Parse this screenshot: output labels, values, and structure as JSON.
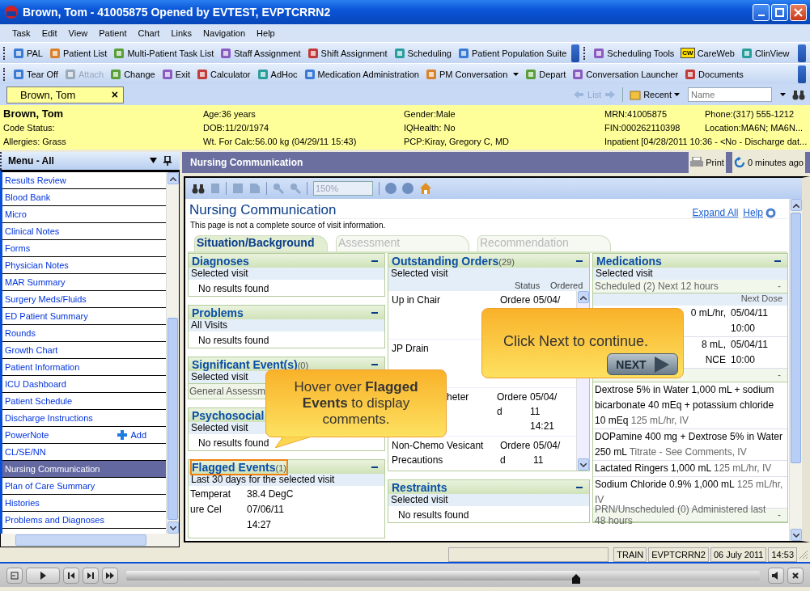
{
  "window": {
    "title": "Brown, Tom - 41005875 Opened by EVTEST, EVPTCRRN2"
  },
  "menu": [
    "Task",
    "Edit",
    "View",
    "Patient",
    "Chart",
    "Links",
    "Navigation",
    "Help"
  ],
  "toolbar_1": {
    "left": [
      {
        "label": "PAL"
      },
      {
        "label": "Patient List"
      },
      {
        "label": "Multi-Patient Task List"
      },
      {
        "label": "Staff Assignment"
      },
      {
        "label": "Shift Assignment"
      },
      {
        "label": "Scheduling"
      },
      {
        "label": "Patient Population Suite"
      }
    ],
    "right": [
      {
        "label": "Scheduling Tools"
      },
      {
        "label": "CareWeb",
        "icon_text": "CW"
      },
      {
        "label": "ClinView"
      }
    ]
  },
  "toolbar_2": [
    {
      "label": "Tear Off",
      "disabled": false,
      "dropdown": false
    },
    {
      "label": "Attach",
      "disabled": true,
      "dropdown": false
    },
    {
      "label": "Change",
      "disabled": false,
      "dropdown": false
    },
    {
      "label": "Exit",
      "disabled": false,
      "dropdown": false
    },
    {
      "label": "Calculator",
      "disabled": false,
      "dropdown": false
    },
    {
      "label": "AdHoc",
      "disabled": false,
      "dropdown": false
    },
    {
      "label": "Medication Administration",
      "disabled": false,
      "dropdown": false
    },
    {
      "label": "PM Conversation",
      "disabled": false,
      "dropdown": true
    },
    {
      "label": "Depart",
      "disabled": false,
      "dropdown": false
    },
    {
      "label": "Conversation Launcher",
      "disabled": false,
      "dropdown": false
    },
    {
      "label": "Documents",
      "disabled": false,
      "dropdown": false
    }
  ],
  "patient_tab": {
    "label": "Brown, Tom",
    "close": "×"
  },
  "nav": {
    "list": "List",
    "recent": "Recent",
    "placeholder": "Name"
  },
  "banner": [
    [
      "Brown, Tom",
      "Age:36 years",
      "Gender:Male",
      "MRN:41005875",
      "Phone:(317) 555-1212"
    ],
    [
      "Code Status:",
      "DOB:11/20/1974",
      "IQHealth: No",
      "FIN:000262110398",
      "Location:MA6N; MA6N..."
    ],
    [
      "Allergies: Grass",
      "Wt. For Calc:56.00 kg (04/29/11 15:43)",
      "PCP:Kiray, Gregory C, MD",
      "Inpatient [04/28/2011 10:36 - <No - Discharge dat..."
    ]
  ],
  "sidebar": {
    "title": "Menu - All",
    "items": [
      {
        "label": "Results Review",
        "selected": false
      },
      {
        "label": "Blood Bank",
        "selected": false
      },
      {
        "label": "Micro",
        "selected": false
      },
      {
        "label": "Clinical Notes",
        "selected": false
      },
      {
        "label": "Forms",
        "selected": false
      },
      {
        "label": "Physician Notes",
        "selected": false
      },
      {
        "label": "MAR Summary",
        "selected": false
      },
      {
        "label": "Surgery Meds/Fluids",
        "selected": false
      },
      {
        "label": "ED Patient Summary",
        "selected": false
      },
      {
        "label": "Rounds",
        "selected": false
      },
      {
        "label": "Growth Chart",
        "selected": false
      },
      {
        "label": "Patient Information",
        "selected": false
      },
      {
        "label": "ICU Dashboard",
        "selected": false
      },
      {
        "label": "Patient Schedule",
        "selected": false
      },
      {
        "label": "Discharge Instructions",
        "selected": false
      },
      {
        "label": "PowerNote",
        "selected": false,
        "action": "Add"
      },
      {
        "label": "CL/SE/NN",
        "selected": false
      },
      {
        "label": "Nursing Communication",
        "selected": true
      },
      {
        "label": "Plan of Care Summary",
        "selected": false
      },
      {
        "label": "Histories",
        "selected": false
      },
      {
        "label": "Problems and Diagnoses",
        "selected": false
      }
    ]
  },
  "content_header": {
    "title": "Nursing Communication",
    "print": "Print",
    "refresh": "0 minutes ago"
  },
  "page_toolbar": {
    "zoom": "150%"
  },
  "page": {
    "title": "Nursing Communication",
    "note": "This page is not a complete source of visit information.",
    "links": [
      "Expand All",
      "Help"
    ],
    "tabs": [
      {
        "label": "Situation/Background",
        "selected": true
      },
      {
        "label": "Assessment",
        "selected": false
      },
      {
        "label": "Recommendation",
        "selected": false
      }
    ],
    "columns": [
      {
        "sections": [
          {
            "kind": "empty",
            "title": "Diagnoses",
            "highlighted": false,
            "scope": "Selected visit",
            "message": "No results found"
          },
          {
            "kind": "empty",
            "title": "Problems",
            "highlighted": false,
            "scope": "All Visits",
            "message": "No results found"
          },
          {
            "kind": "note",
            "title": "Significant Event(s)",
            "count": "(0)",
            "highlighted": false,
            "scope": "Selected visit",
            "message": "General Assessm"
          },
          {
            "kind": "empty",
            "title": "Psychosocial",
            "highlighted": false,
            "scope": "Selected visit",
            "message": "No results found"
          },
          {
            "kind": "flagged",
            "title": "Flagged Events",
            "count": "(1)",
            "highlighted": true,
            "scope": "Last 30 days for the selected visit",
            "rows": [
              {
                "name": [
                  "Temperat",
                  "ure Cel"
                ],
                "value": [
                  "38.4 DegC",
                  "07/06/11",
                  "14:27"
                ]
              }
            ]
          }
        ]
      },
      {
        "sections": [
          {
            "kind": "orders",
            "title": "Outstanding Orders",
            "count": "(29)",
            "highlighted": false,
            "scope": "Selected visit",
            "columns": [
              "Status",
              "Ordered"
            ],
            "rows": [
              {
                "cut": false,
                "name": [
                  "Up in Chair"
                ],
                "status": [
                  "Ordere"
                ],
                "ordered": [
                  "05/04/"
                ]
              },
              {
                "cut": false,
                "name": [
                  "JP Drain"
                ]
              },
              {
                "cut": true,
                "name": [
                  "heter"
                ],
                "status": [
                  "Ordere",
                  "d"
                ],
                "ordered": [
                  "05/04/",
                  "11",
                  "14:21"
                ]
              },
              {
                "cut": false,
                "name": [
                  "Non-Chemo Vesicant",
                  "Precautions"
                ],
                "status": [
                  "Ordere",
                  "d"
                ],
                "ordered": [
                  "05/04/",
                  "11"
                ]
              }
            ]
          },
          {
            "kind": "empty",
            "title": "Restraints",
            "highlighted": false,
            "scope": "Selected visit",
            "message": "No results found"
          }
        ]
      },
      {
        "sections": [
          {
            "kind": "medications",
            "title": "Medications",
            "highlighted": false,
            "scope": "Selected visit",
            "groups": [
              {
                "label": "Scheduled (2) Next 12 hours",
                "toggle": "-",
                "column": "Next Dose",
                "rows": [
                  {
                    "cut": true,
                    "name": [
                      "0 mL/hr,"
                    ],
                    "dose": [
                      "05/04/11",
                      "10:00"
                    ]
                  },
                  {
                    "cut": true,
                    "name": [
                      "8 mL,",
                      "NCE"
                    ],
                    "dose": [
                      "05/04/11",
                      "10:00"
                    ]
                  }
                ]
              },
              {
                "toggle": "-",
                "items": [
                  {
                    "name": "Dextrose 5% in Water 1,000 mL + sodium bicarbonate 40 mEq + potassium chloride 10 mEq",
                    "detail": "125 mL/hr, IV"
                  },
                  {
                    "name": "DOPamine 400 mg + Dextrose 5% in Water 250 mL",
                    "detail": "Titrate - See Comments, IV"
                  },
                  {
                    "name": "Lactated Ringers 1,000 mL",
                    "detail": "125 mL/hr, IV"
                  },
                  {
                    "name": "Sodium Chloride 0.9% 1,000 mL",
                    "detail": "125 mL/hr, IV"
                  }
                ]
              },
              {
                "label": "PRN/Unscheduled (0) Administered last 48 hours",
                "toggle": "-"
              }
            ]
          }
        ]
      }
    ]
  },
  "callouts": [
    {
      "kind": "hover",
      "text": "Hover over **Flagged Events** to display comments."
    },
    {
      "kind": "next",
      "text": "Click Next to continue.",
      "button": "NEXT"
    }
  ],
  "status_bar": [
    "TRAIN",
    "EVPTCRRN2",
    "06 July 2011",
    "14:53"
  ],
  "player": {
    "level": 0.71
  }
}
